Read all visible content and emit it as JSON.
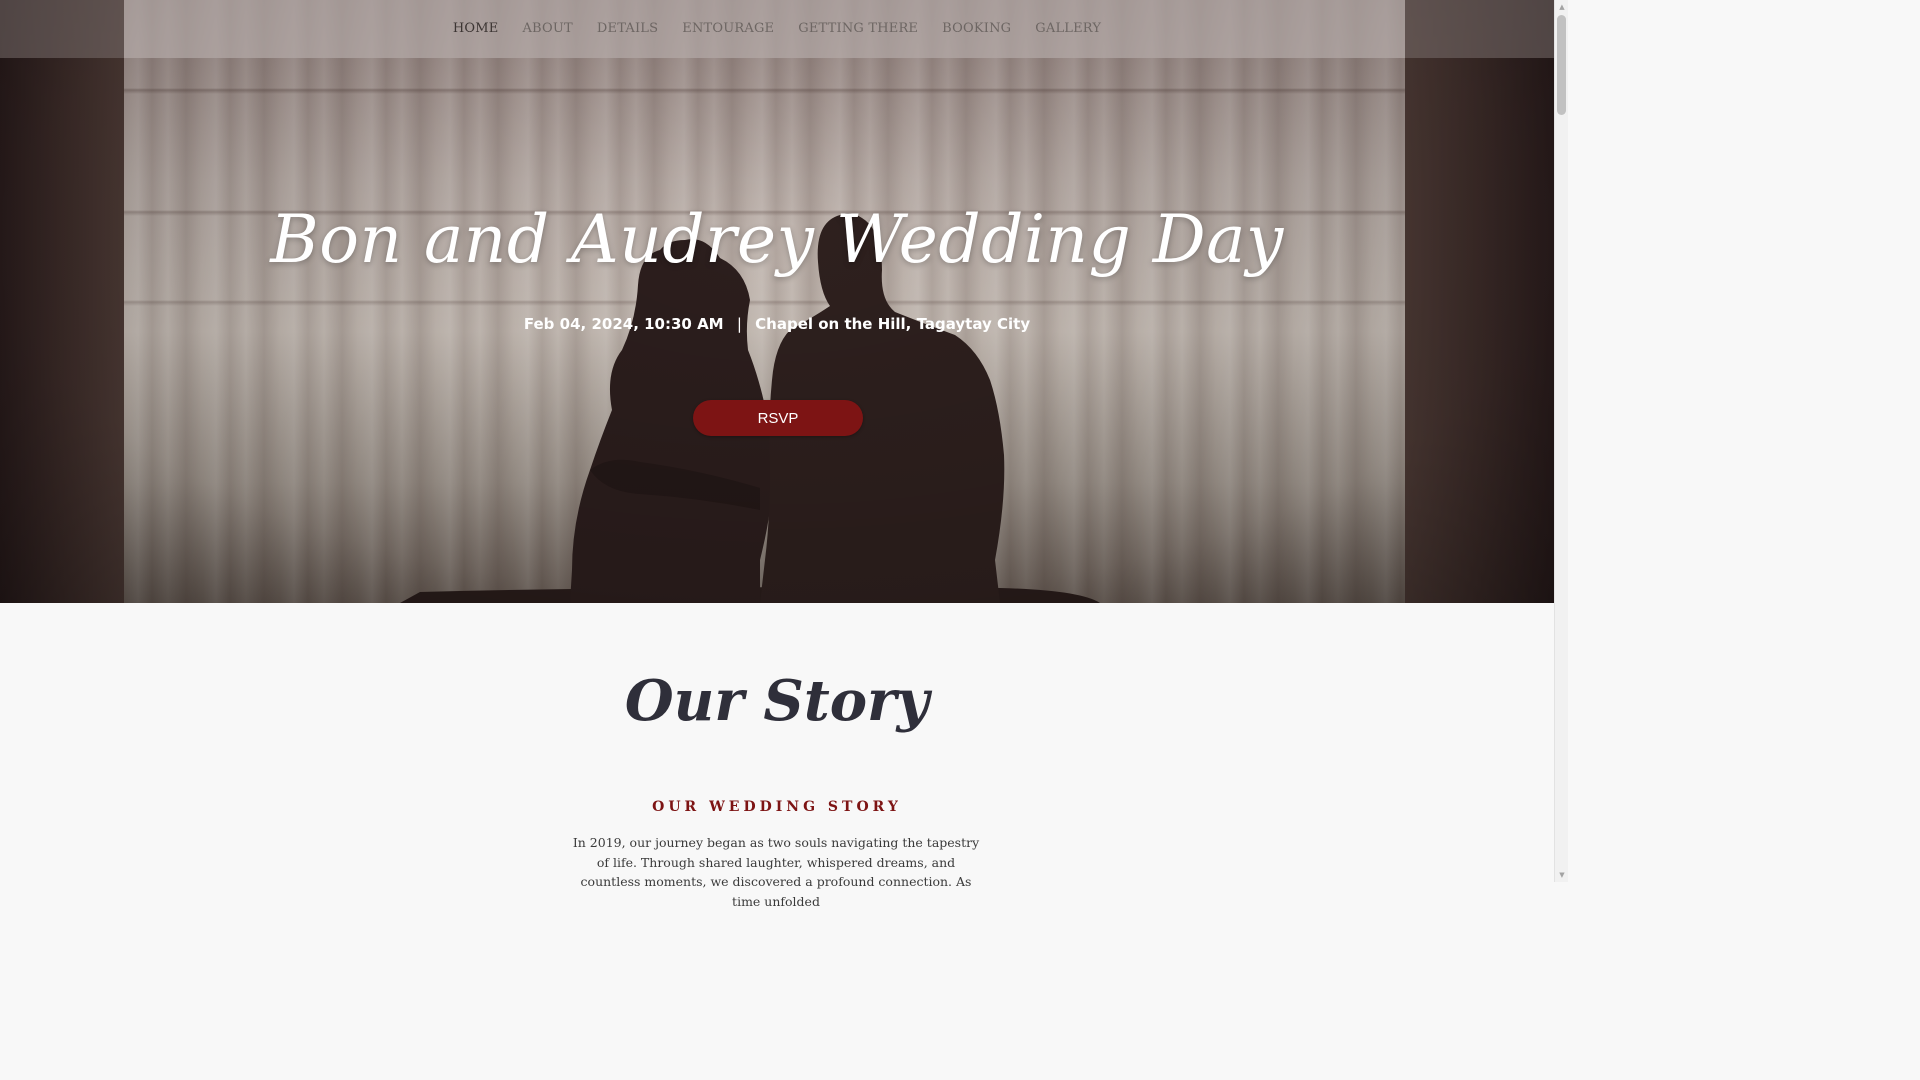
{
  "nav": {
    "items": [
      {
        "label": "HOME",
        "active": true
      },
      {
        "label": "ABOUT",
        "active": false
      },
      {
        "label": "DETAILS",
        "active": false
      },
      {
        "label": "ENTOURAGE",
        "active": false
      },
      {
        "label": "GETTING THERE",
        "active": false
      },
      {
        "label": "BOOKING",
        "active": false
      },
      {
        "label": "GALLERY",
        "active": false
      }
    ]
  },
  "hero": {
    "title": "Bon and Audrey Wedding Day",
    "date_time": "Feb 04, 2024, 10:30 AM",
    "separator": "|",
    "venue": "Chapel on the Hill, Tagaytay City",
    "rsvp_label": "RSVP"
  },
  "story": {
    "title": "Our Story",
    "heading": "OUR WEDDING STORY",
    "text": "In 2019, our journey began as two souls navigating the tapestry of life. Through shared laughter, whispered dreams, and countless moments, we discovered a profound connection. As time unfolded"
  },
  "colors": {
    "accent": "#7d1414",
    "hero_dark": "#2c1f1e",
    "story_bg": "#f8f8f8"
  },
  "icons": {
    "scroll_up": "chevron-up-icon",
    "scroll_down": "chevron-down-icon"
  }
}
